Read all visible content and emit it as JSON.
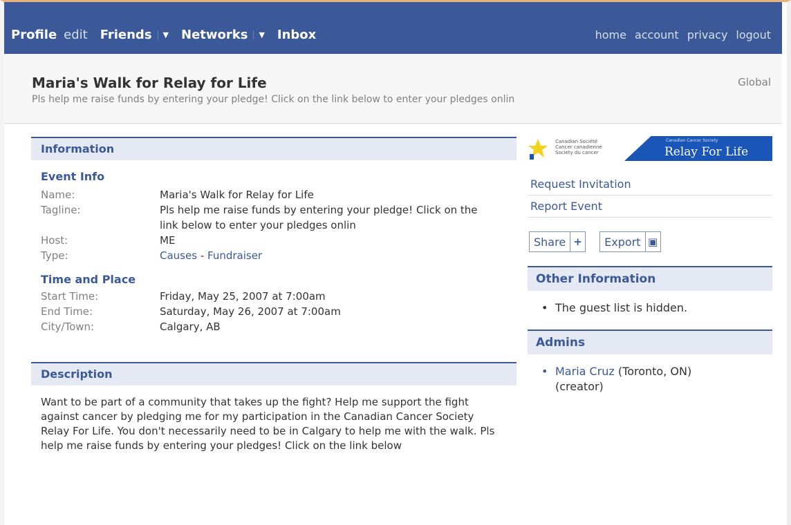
{
  "nav": {
    "profile": "Profile",
    "edit": "edit",
    "friends": "Friends",
    "networks": "Networks",
    "inbox": "Inbox",
    "caret": "▼",
    "right_links": [
      "home",
      "account",
      "privacy",
      "logout"
    ]
  },
  "event": {
    "title": "Maria's Walk for Relay for Life",
    "tagline": "Pls help me raise funds by entering your pledge! Click on the link below to enter your pledges onlin",
    "scope": "Global"
  },
  "information": {
    "heading": "Information",
    "event_info": {
      "heading": "Event Info",
      "rows": [
        {
          "label": "Name:",
          "value": "Maria's Walk for Relay for Life"
        },
        {
          "label": "Tagline:",
          "value": "Pls help me raise funds by entering your pledge! Click on the link below to enter your pledges onlin"
        },
        {
          "label": "Host:",
          "value": "ME"
        }
      ],
      "type_label": "Type:",
      "type_category": "Causes",
      "type_separator": "-",
      "type_subcategory": "Fundraiser"
    },
    "time_place": {
      "heading": "Time and Place",
      "rows": [
        {
          "label": "Start Time:",
          "value": "Friday, May 25, 2007 at 7:00am"
        },
        {
          "label": "End Time:",
          "value": "Saturday, May 26, 2007 at 7:00am"
        },
        {
          "label": "City/Town:",
          "value": "Calgary, AB"
        }
      ]
    }
  },
  "description": {
    "heading": "Description",
    "text": "Want to be part of a community that takes up the fight? Help me support the fight against cancer by pledging me for my participation in the Canadian Cancer Society Relay For Life. You don't necessarily need to be in Calgary to help me with the walk. Pls help me raise funds by entering your pledges! Click on the link below"
  },
  "sidebar": {
    "banner": {
      "org_lines": [
        "Canadian  Société",
        "Cancer   canadienne",
        "Society   du cancer"
      ],
      "tag": "Canadian Cancer Society",
      "title": "Relay For Life"
    },
    "links": [
      "Request Invitation",
      "Report Event"
    ],
    "share": {
      "label": "Share",
      "icon": "+"
    },
    "export": {
      "label": "Export",
      "icon": "▣"
    },
    "other_info": {
      "heading": "Other Information",
      "items": [
        "The guest list is hidden."
      ]
    },
    "admins": {
      "heading": "Admins",
      "name": "Maria Cruz",
      "detail": "(Toronto, ON)",
      "role": "(creator)"
    }
  },
  "colors": {
    "brand": "#3b5998",
    "section_bg": "#e5e9f3",
    "relay_blue": "#1a56b7",
    "logo_yellow": "#f2d21b"
  }
}
